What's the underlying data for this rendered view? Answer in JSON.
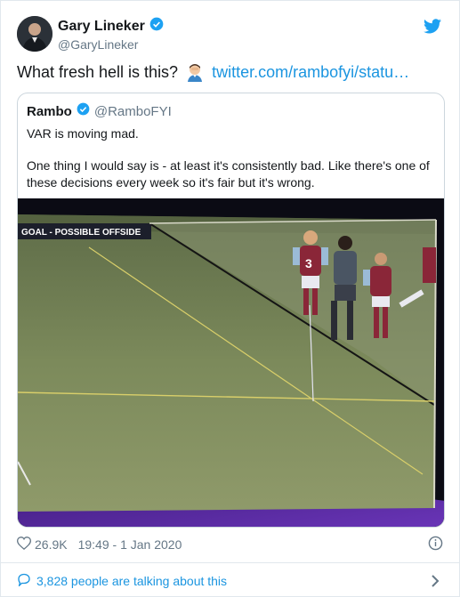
{
  "tweet": {
    "author_name": "Gary Lineker",
    "author_handle": "@GaryLineker",
    "text": "What fresh hell is this?",
    "link": "twitter.com/rambofyi/statu…"
  },
  "quote": {
    "author_name": "Rambo",
    "author_handle": "@RamboFYI",
    "line1": "VAR is moving mad.",
    "line2": "One thing I would say is - at least it's consistently bad. Like there's one of",
    "line3": "these decisions every week so it's fair but it's wrong.",
    "media_caption": "GOAL - POSSIBLE OFFSIDE",
    "shirt_number": "3"
  },
  "footer": {
    "likes": "26.9K",
    "timestamp": "19:49 - 1 Jan 2020",
    "talking": "3,828 people are talking about this"
  },
  "colors": {
    "twitter_blue": "#1da1f2",
    "link_blue": "#1b95e0",
    "muted": "#657786",
    "pitch": "#6b7a52",
    "broadcast_purple": "#5b2ca0"
  }
}
